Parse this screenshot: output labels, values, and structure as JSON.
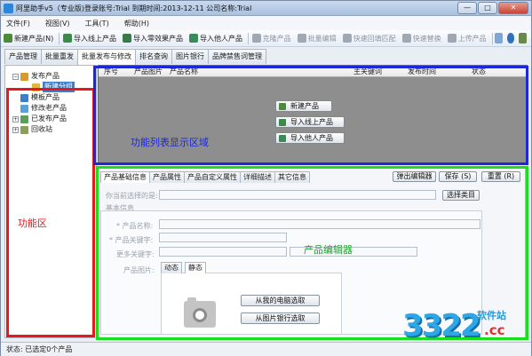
{
  "window": {
    "title": "阿里助手v5（专业版)登录账号:Trial  到期时间:2013-12-11   公司名称:Trial",
    "min": "—",
    "max": "□",
    "close": "✕"
  },
  "menu": [
    "文件(F)",
    "视图(V)",
    "工具(T)",
    "帮助(H)"
  ],
  "toolbar": [
    {
      "label": "新建产品(N)",
      "color": "#4a8a3a"
    },
    {
      "label": "导入线上产品",
      "color": "#3a8a4a"
    },
    {
      "label": "导入零效果产品",
      "color": "#3a7a4a"
    },
    {
      "label": "导入他人产品",
      "color": "#3a8a5a"
    },
    {
      "label": "克隆产品",
      "color": "#a0a8b4"
    },
    {
      "label": "批量编辑",
      "color": "#a0a8b4"
    },
    {
      "label": "快速回填匹配",
      "color": "#a0a8b4"
    },
    {
      "label": "快速替换",
      "color": "#a0a8b4"
    },
    {
      "label": "上传产品",
      "color": "#a0a8b4"
    }
  ],
  "main_tabs": [
    "产品管理",
    "批量重发",
    "批量发布与修改",
    "排名查询",
    "图片银行",
    "品牌禁售词管理"
  ],
  "tree": {
    "root": "发布产品",
    "selected": "新建分组",
    "items": [
      "模板产品",
      "修改老产品",
      "已发布产品",
      "回收站"
    ]
  },
  "list": {
    "columns": [
      "序号",
      "产品图片",
      "产品名称",
      "主关键词",
      "发布时间",
      "状态"
    ],
    "buttons": [
      "新建产品",
      "导入线上产品",
      "导入他人产品"
    ]
  },
  "editor": {
    "tabs": [
      "产品基础信息",
      "产品属性",
      "产品自定义属性",
      "详细描述",
      "其它信息"
    ],
    "top_buttons": [
      "弹出编辑器",
      "保存 (S)",
      "重置 (R)"
    ],
    "category_label": "你当前选择的是:",
    "category_button": "选择类目",
    "section_basic": "基本信息",
    "field_name": "* 产品名称:",
    "field_keyword": "* 产品关键字:",
    "field_more_keywords": "更多关键字:",
    "field_images": "产品图片:",
    "image_tabs": [
      "动态",
      "静态"
    ],
    "image_buttons": [
      "从我的电脑选取",
      "从图片银行选取"
    ]
  },
  "annotations": {
    "red": "功能区",
    "blue": "功能列表显示区域",
    "green": "产品编辑器"
  },
  "status": {
    "label": "状态:",
    "text": "已选定0个产品"
  },
  "watermark": {
    "number": "3322",
    "site": "软件站",
    "domain": ".cc"
  }
}
